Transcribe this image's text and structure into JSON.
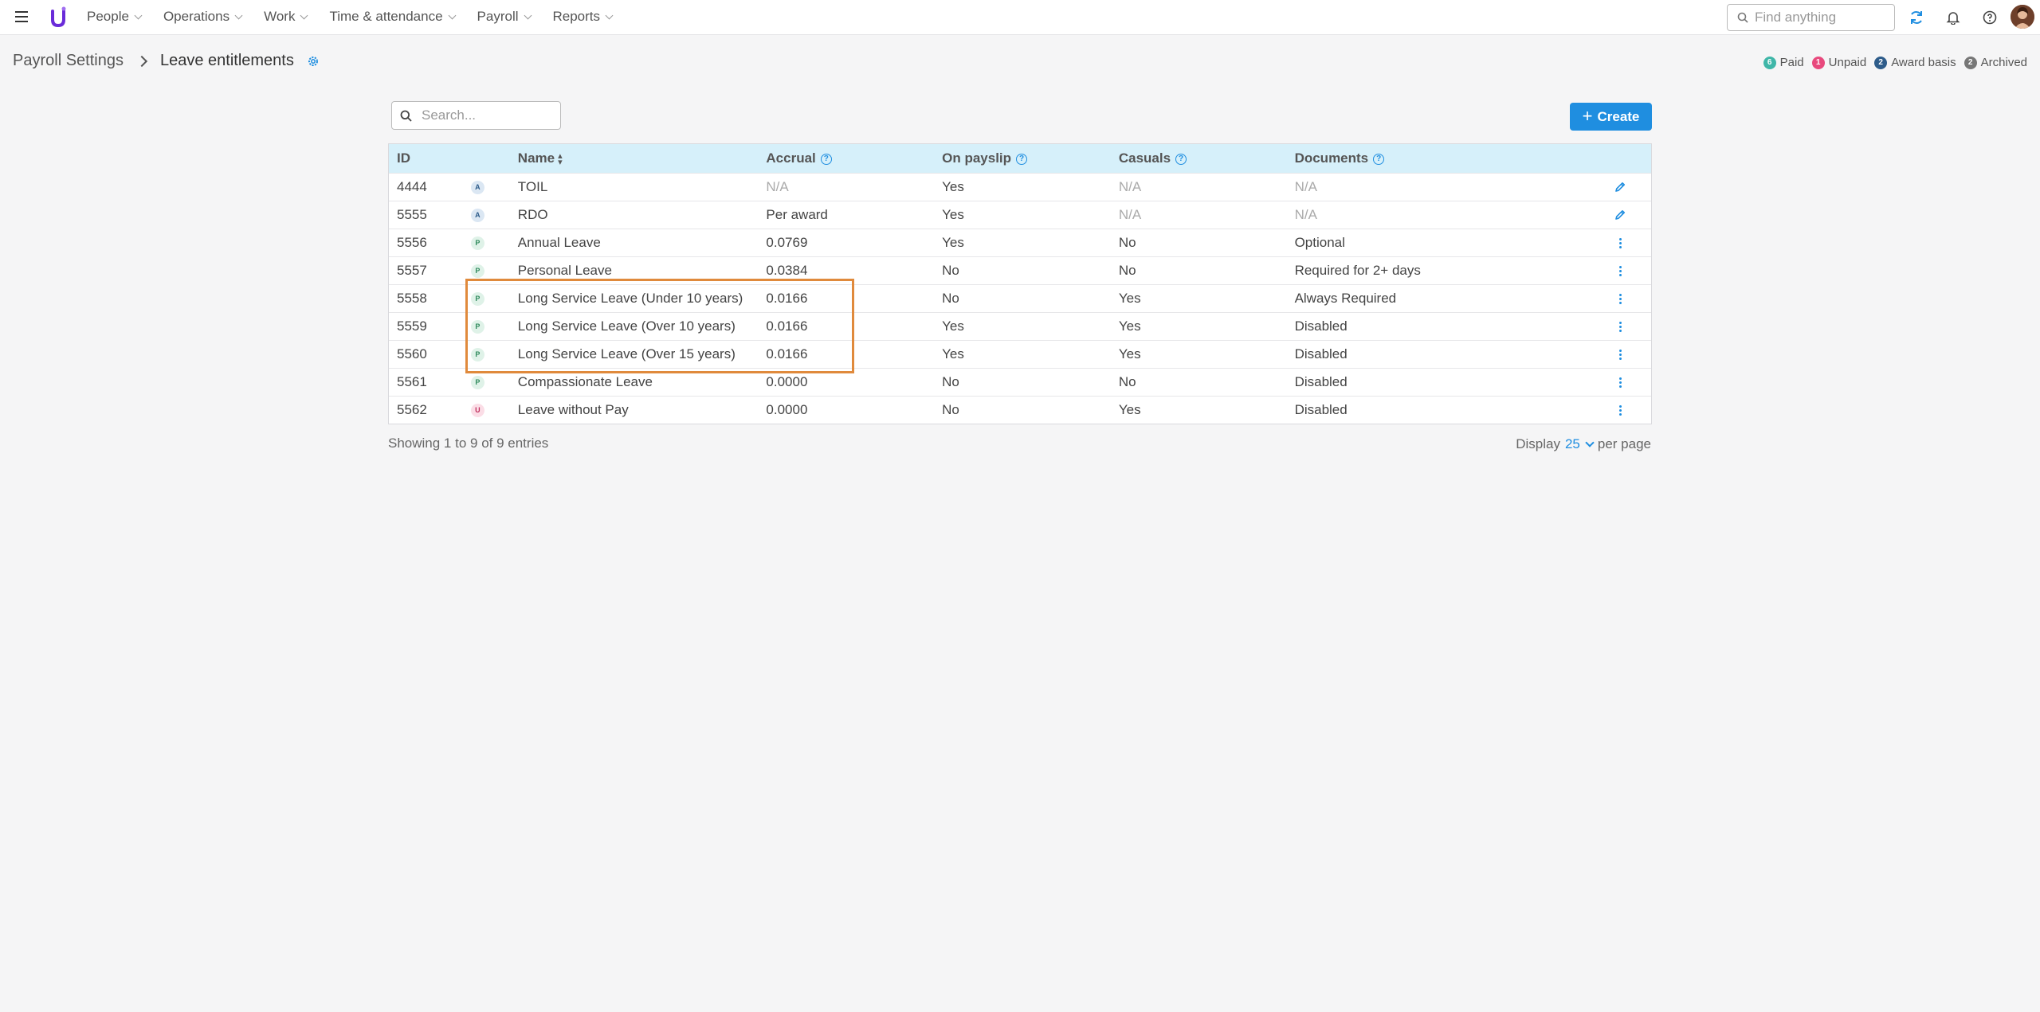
{
  "nav": {
    "items": [
      {
        "label": "People"
      },
      {
        "label": "Operations"
      },
      {
        "label": "Work"
      },
      {
        "label": "Time & attendance"
      },
      {
        "label": "Payroll"
      },
      {
        "label": "Reports"
      }
    ],
    "search_placeholder": "Find anything"
  },
  "header": {
    "breadcrumb_parent": "Payroll Settings",
    "breadcrumb_current": "Leave entitlements"
  },
  "legend": [
    {
      "count": "6",
      "label": "Paid",
      "color": "#3fb6a8"
    },
    {
      "count": "1",
      "label": "Unpaid",
      "color": "#e8497d"
    },
    {
      "count": "2",
      "label": "Award basis",
      "color": "#2e5c8a"
    },
    {
      "count": "2",
      "label": "Archived",
      "color": "#777777"
    }
  ],
  "toolbar": {
    "search_placeholder": "Search...",
    "create_label": "Create"
  },
  "table": {
    "columns": {
      "id": "ID",
      "name": "Name",
      "accrual": "Accrual",
      "payslip": "On payslip",
      "casuals": "Casuals",
      "documents": "Documents"
    },
    "rows": [
      {
        "id": "4444",
        "type": "A",
        "name": "TOIL",
        "accrual": "N/A",
        "payslip": "Yes",
        "casuals": "N/A",
        "documents": "N/A",
        "action": "edit"
      },
      {
        "id": "5555",
        "type": "A",
        "name": "RDO",
        "accrual": "Per award",
        "payslip": "Yes",
        "casuals": "N/A",
        "documents": "N/A",
        "action": "edit"
      },
      {
        "id": "5556",
        "type": "P",
        "name": "Annual Leave",
        "accrual": "0.0769",
        "payslip": "Yes",
        "casuals": "No",
        "documents": "Optional",
        "action": "menu"
      },
      {
        "id": "5557",
        "type": "P",
        "name": "Personal Leave",
        "accrual": "0.0384",
        "payslip": "No",
        "casuals": "No",
        "documents": "Required for 2+ days",
        "action": "menu"
      },
      {
        "id": "5558",
        "type": "P",
        "name": "Long Service Leave (Under 10 years)",
        "accrual": "0.0166",
        "payslip": "No",
        "casuals": "Yes",
        "documents": "Always Required",
        "action": "menu"
      },
      {
        "id": "5559",
        "type": "P",
        "name": "Long Service Leave (Over 10 years)",
        "accrual": "0.0166",
        "payslip": "Yes",
        "casuals": "Yes",
        "documents": "Disabled",
        "action": "menu"
      },
      {
        "id": "5560",
        "type": "P",
        "name": "Long Service Leave (Over 15 years)",
        "accrual": "0.0166",
        "payslip": "Yes",
        "casuals": "Yes",
        "documents": "Disabled",
        "action": "menu"
      },
      {
        "id": "5561",
        "type": "P",
        "name": "Compassionate Leave",
        "accrual": "0.0000",
        "payslip": "No",
        "casuals": "No",
        "documents": "Disabled",
        "action": "menu"
      },
      {
        "id": "5562",
        "type": "U",
        "name": "Leave without Pay",
        "accrual": "0.0000",
        "payslip": "No",
        "casuals": "Yes",
        "documents": "Disabled",
        "action": "menu"
      }
    ]
  },
  "footer": {
    "showing": "Showing 1 to 9 of 9 entries",
    "display_prefix": "Display",
    "per_page": "25",
    "display_suffix": "per page"
  },
  "colors": {
    "accent": "#1f8ee0",
    "header_row": "#d6f0fa",
    "highlight": "#e08a3c",
    "logo": "#6a2bd9"
  }
}
